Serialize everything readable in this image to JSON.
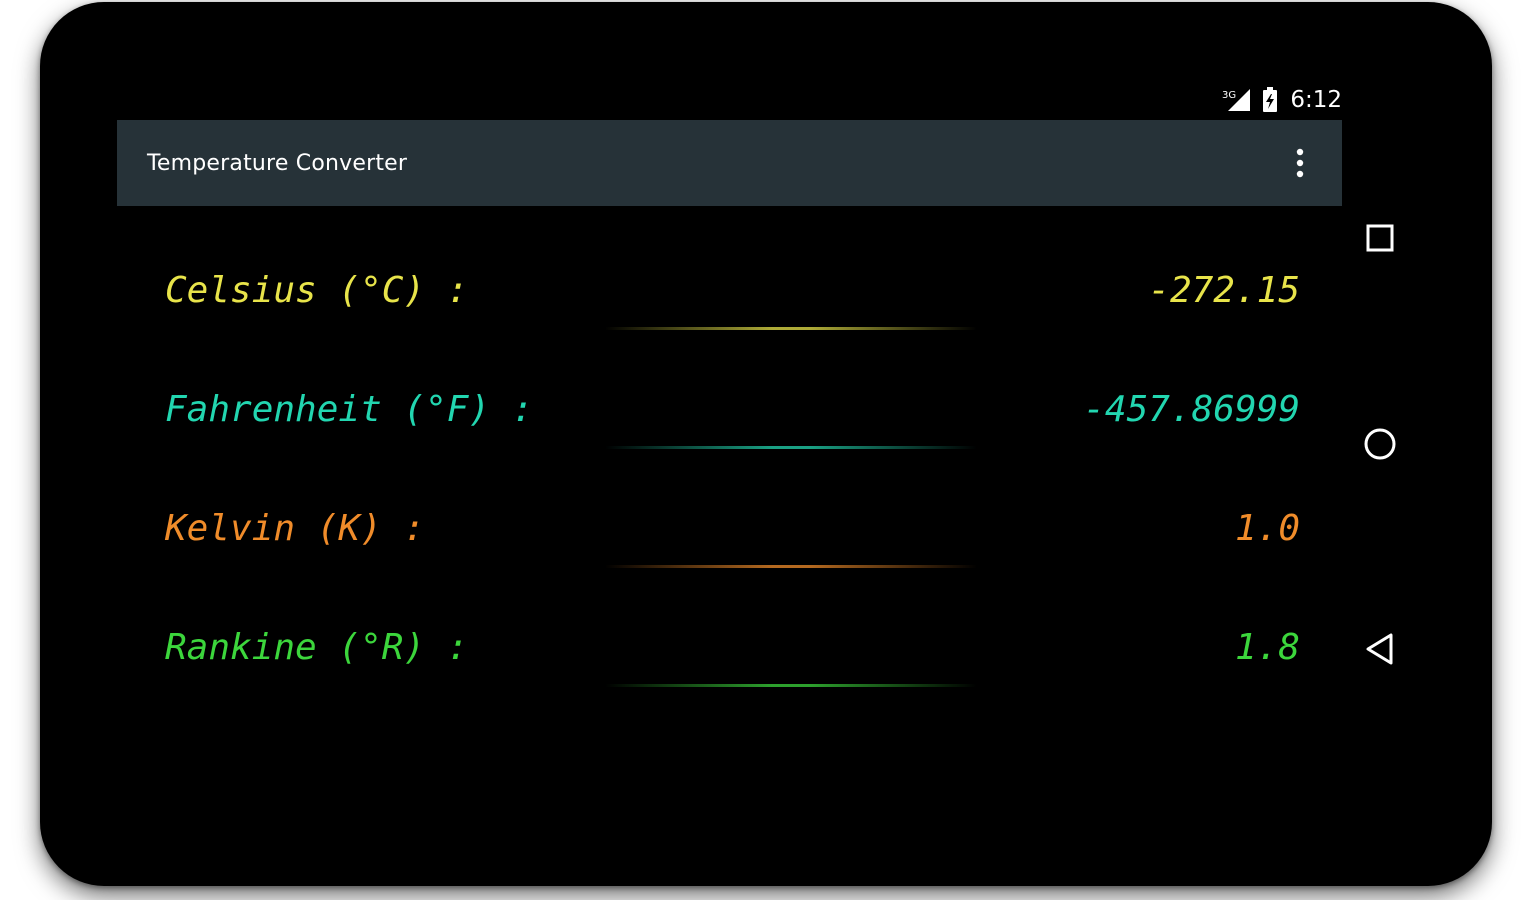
{
  "status_bar": {
    "network_label": "3G",
    "time": "6:12",
    "signal_icon": "cell-signal-icon",
    "battery_icon": "battery-charging-icon"
  },
  "action_bar": {
    "title": "Temperature Converter",
    "overflow_icon": "more-vert-icon"
  },
  "conversions": [
    {
      "label": "Celsius (°C) :",
      "value": "-272.15",
      "color": "#e8e44a"
    },
    {
      "label": "Fahrenheit (°F) :",
      "value": "-457.86999",
      "color": "#22d6b0"
    },
    {
      "label": "Kelvin (K) :",
      "value": "1.0",
      "color": "#f08c2a"
    },
    {
      "label": "Rankine (°R) :",
      "value": "1.8",
      "color": "#3cd63c"
    }
  ],
  "nav_bar": {
    "recents_icon": "square-recents-icon",
    "home_icon": "circle-home-icon",
    "back_icon": "triangle-back-icon"
  },
  "colors": {
    "action_bar_bg": "#263238",
    "background": "#000000"
  }
}
